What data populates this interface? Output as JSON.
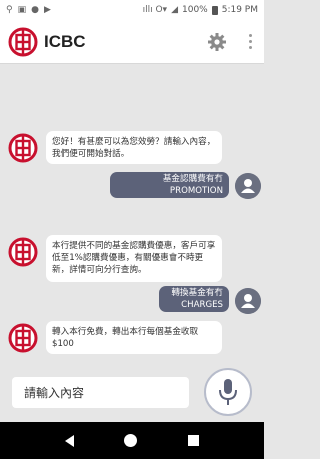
{
  "status_bar": {
    "left_icons": [
      "location-icon",
      "image-icon",
      "record-icon",
      "play-icon"
    ],
    "signal_text": "ıllı O▾",
    "battery_percent": "100%",
    "time": "5:19 PM"
  },
  "header": {
    "brand_name": "ICBC",
    "brand_color": "#c8102e"
  },
  "messages": [
    {
      "from": "bot",
      "text": "您好！有甚麼可以為您效勞？請輸入內容，我們便可開始對話。"
    },
    {
      "from": "user",
      "text": "基金認購費有冇PROMOTION"
    },
    {
      "from": "bot",
      "text": "本行提供不同的基金認購費優惠，客戶可享低至1%認購費優惠，有關優惠會不時更新，詳情可向分行查詢。"
    },
    {
      "from": "user",
      "text": "轉換基金有冇CHARGES"
    },
    {
      "from": "bot",
      "text": "轉入本行免費，轉出本行每個基金收取 $100"
    }
  ],
  "input": {
    "placeholder": "請輸入內容"
  },
  "colors": {
    "chat_background": "#e6e6e6",
    "user_bubble": "#5c6279",
    "bot_bubble": "#ffffff"
  }
}
